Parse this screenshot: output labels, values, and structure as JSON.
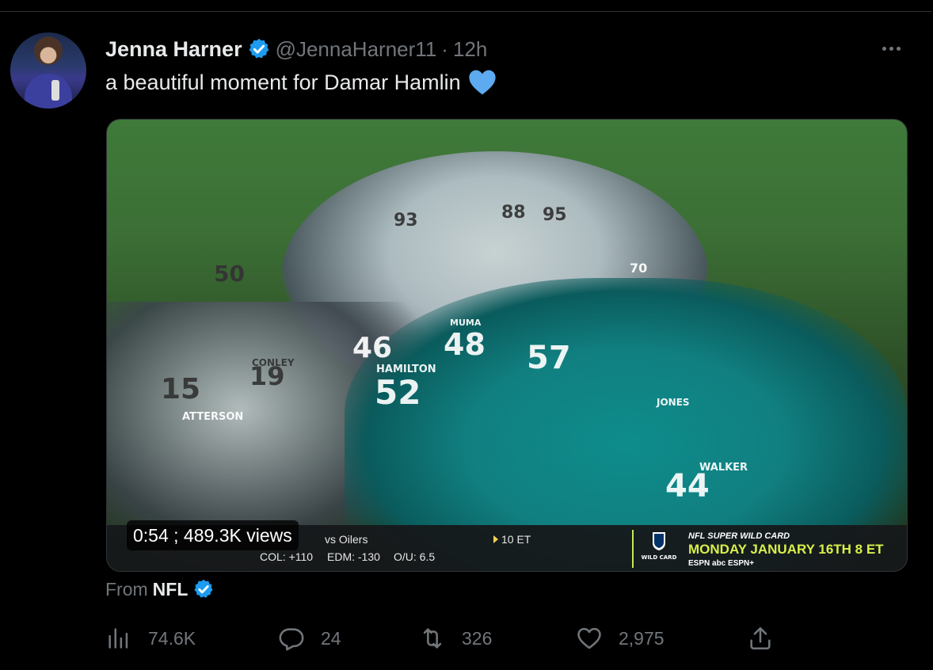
{
  "tweet": {
    "author_name": "Jenna Harner",
    "handle": "@JennaHarner11",
    "separator": "·",
    "time": "12h",
    "text": "a beautiful moment for Damar Hamlin",
    "emoji": "blue-heart",
    "more_icon": "more-horizontal-icon"
  },
  "media": {
    "overlay": "0:54 ; 489.3K views",
    "ticker": {
      "line1": "vs  Oilers",
      "line2_col": "COL: +110",
      "line2_edm": "EDM: -130",
      "line2_ou": "O/U: 6.5",
      "time": "10 ET",
      "promo_top": "NFL SUPER WILD CARD",
      "promo_main": "MONDAY JANUARY 16TH 8 ET",
      "promo_networks": "ESPN  abc  ESPN+",
      "badge": "WILD CARD"
    },
    "jersey_numbers": [
      "93",
      "88",
      "95",
      "46",
      "48",
      "57",
      "52",
      "50",
      "15",
      "19",
      "44",
      "70"
    ],
    "jersey_names": [
      "MUMA",
      "JONES",
      "WALKER",
      "HAMILTON",
      "ATTERSON",
      "CONLEY"
    ]
  },
  "source": {
    "prefix": "From",
    "name": "NFL"
  },
  "actions": {
    "views": "74.6K",
    "replies": "24",
    "retweets": "326",
    "likes": "2,975"
  },
  "colors": {
    "background": "#000000",
    "verified": "#1d9bf0",
    "muted": "#71767b",
    "text": "#e7e9ea",
    "heart_emoji": "#5daaf0"
  }
}
